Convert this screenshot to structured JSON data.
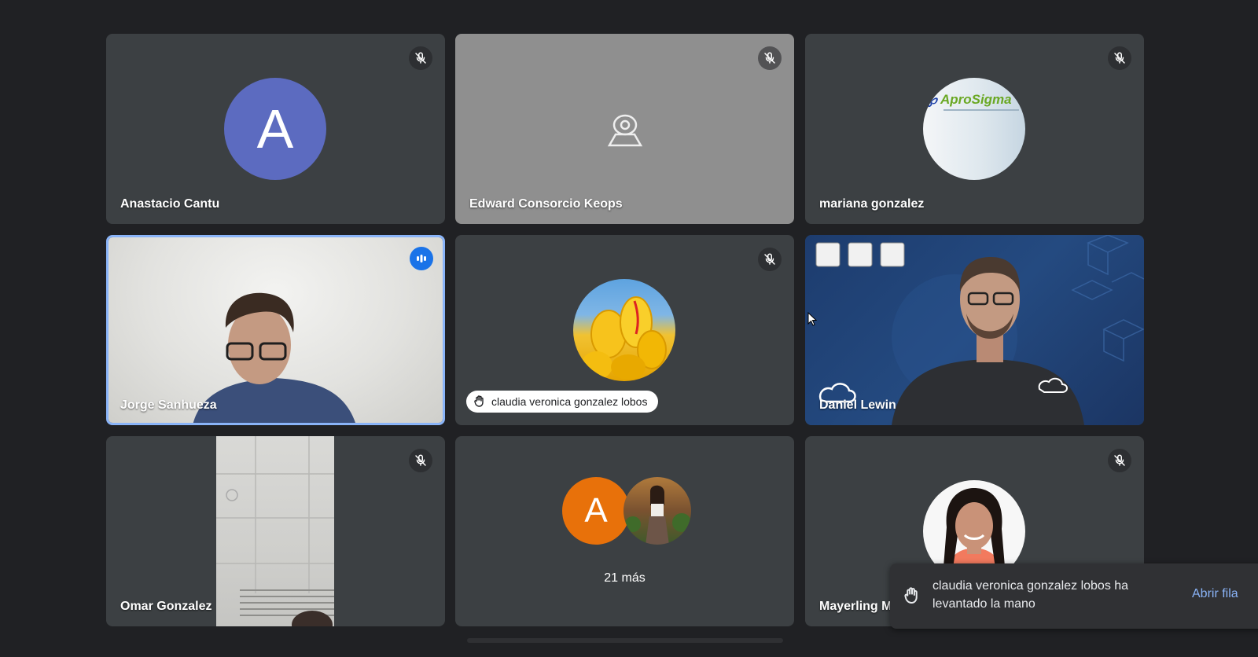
{
  "participants": [
    {
      "name": "Anastacio Cantu",
      "avatar_letter": "A",
      "mic": "muted"
    },
    {
      "name": "Edward Consorcio Keops",
      "mic": "muted",
      "placeholder_icon": "webcam-icon"
    },
    {
      "name": "mariana gonzalez",
      "mic": "muted",
      "logo_text": "AproSigma"
    },
    {
      "name": "Jorge Sanhueza",
      "mic": "speaking"
    },
    {
      "name": "claudia veronica gonzalez lobos",
      "mic": "muted",
      "hand_raised": true
    },
    {
      "name": "Daniel Lewin",
      "mic": "unmuted"
    },
    {
      "name": "Omar Gonzalez",
      "mic": "muted"
    },
    {
      "name": "Mayerling M",
      "mic": "muted"
    }
  ],
  "overflow": {
    "avatar_letter": "A",
    "label": "21 más"
  },
  "toast": {
    "message": "claudia veronica gonzalez lobos ha levantado la mano",
    "action": "Abrir fila"
  },
  "colors": {
    "background": "#202124",
    "tile": "#3c4043",
    "active_border": "#8ab4f8",
    "speaking_badge": "#1a73e8",
    "avatar_blue": "#5c6bc0",
    "avatar_orange": "#e8710a"
  }
}
